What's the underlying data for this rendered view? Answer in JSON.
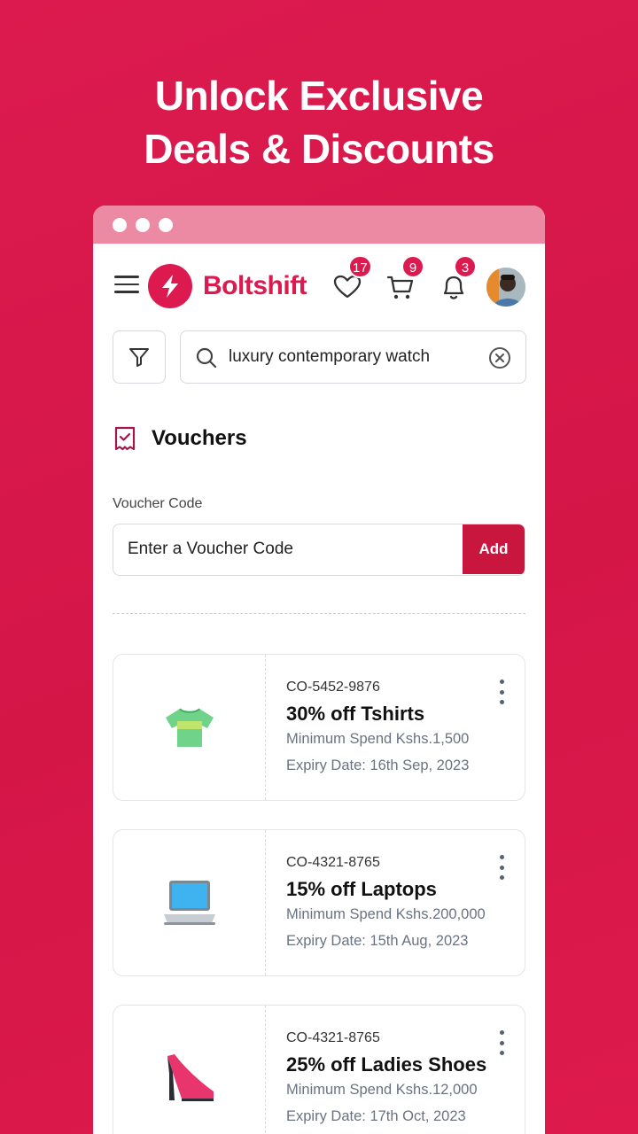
{
  "headline": {
    "line1": "Unlock Exclusive",
    "line2": "Deals & Discounts"
  },
  "brand": {
    "name": "Boltshift",
    "accent": "#dc1a4f"
  },
  "nav": {
    "wishlist_count": "17",
    "cart_count": "9",
    "notifications_count": "3"
  },
  "search": {
    "value": "luxury contemporary watch"
  },
  "vouchers": {
    "title": "Vouchers",
    "field_label": "Voucher Code",
    "placeholder": "Enter a Voucher Code",
    "add_label": "Add",
    "items": [
      {
        "icon": "tshirt-icon",
        "code": "CO-5452-9876",
        "title": "30% off Tshirts",
        "min_spend": "Minimum Spend Kshs.1,500",
        "expiry": "Expiry Date: 16th Sep, 2023"
      },
      {
        "icon": "laptop-icon",
        "code": "CO-4321-8765",
        "title": "15% off Laptops",
        "min_spend": "Minimum Spend Kshs.200,000",
        "expiry": "Expiry Date: 15th Aug, 2023"
      },
      {
        "icon": "high-heel-icon",
        "code": "CO-4321-8765",
        "title": "25% off Ladies Shoes",
        "min_spend": "Minimum Spend Kshs.12,000",
        "expiry": "Expiry Date: 17th Oct, 2023"
      }
    ]
  }
}
